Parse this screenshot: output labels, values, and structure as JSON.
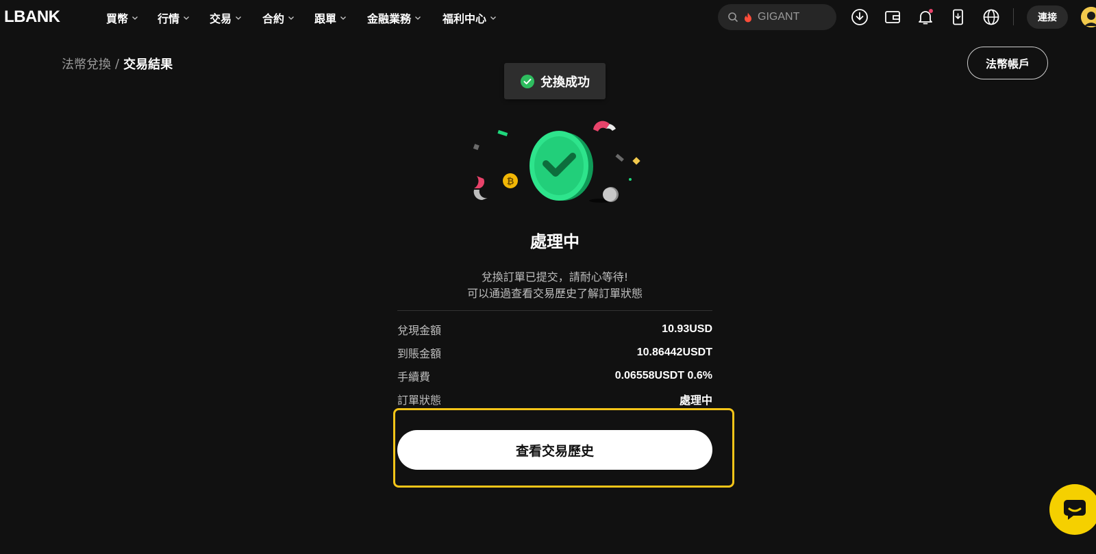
{
  "brand": {
    "logo_text": "LBANK"
  },
  "nav": {
    "items": [
      {
        "label": "買幣"
      },
      {
        "label": "行情"
      },
      {
        "label": "交易"
      },
      {
        "label": "合約"
      },
      {
        "label": "跟單"
      },
      {
        "label": "金融業務"
      },
      {
        "label": "福利中心"
      }
    ],
    "search": {
      "placeholder": "GIGANT",
      "icon": "search-icon"
    },
    "icons": [
      "download-icon",
      "wallet-icon",
      "bell-icon",
      "mobile-download-icon",
      "globe-icon"
    ],
    "connect_label": "連接"
  },
  "breadcrumb": {
    "parent": "法幣兌換",
    "separator": "/",
    "current": "交易結果"
  },
  "fiat_account_button": "法幣帳戶",
  "toast": {
    "message": "兌換成功",
    "icon": "check-circle-icon",
    "color": "#2ebd5f"
  },
  "status": {
    "title": "處理中",
    "line1": "兌換訂單已提交，請耐心等待!",
    "line2": "可以通過查看交易歷史了解訂單狀態"
  },
  "details": [
    {
      "label": "兌現金額",
      "value": "10.93USD"
    },
    {
      "label": "到賬金額",
      "value": "10.86442USDT"
    },
    {
      "label": "手續費",
      "value": "0.06558USDT 0.6%"
    },
    {
      "label": "訂單狀態",
      "value": "處理中"
    }
  ],
  "action": {
    "view_history": "查看交易歷史"
  },
  "colors": {
    "accent": "#f5c518",
    "success": "#1fd87c",
    "background": "#111111"
  }
}
